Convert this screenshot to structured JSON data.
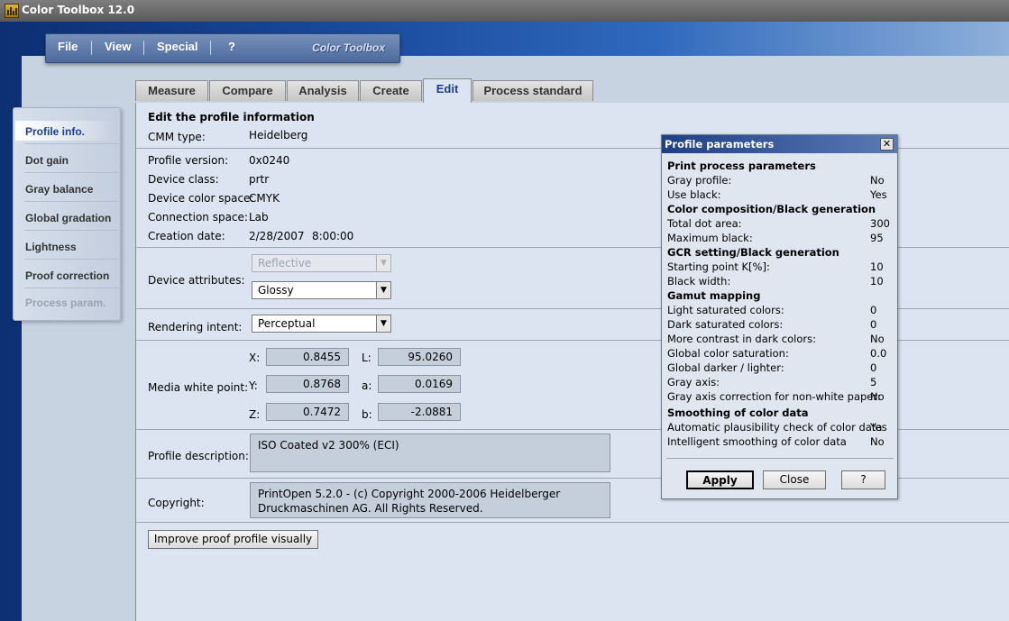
{
  "window": {
    "title": "Color Toolbox 12.0",
    "icon": "app-icon"
  },
  "menu": {
    "items": [
      "File",
      "View",
      "Special",
      "?"
    ],
    "brand": "Color Toolbox"
  },
  "tabs": [
    "Measure",
    "Compare",
    "Analysis",
    "Create",
    "Edit",
    "Process standard"
  ],
  "active_tab": "Edit",
  "sidebar": {
    "items": [
      "Profile info.",
      "Dot gain",
      "Gray balance",
      "Global gradation",
      "Lightness",
      "Proof correction",
      "Process param."
    ],
    "active": "Profile info.",
    "disabled": [
      "Process param."
    ]
  },
  "edit": {
    "heading": "Edit the profile information",
    "cmm_label": "CMM type:",
    "cmm_value": "Heidelberg",
    "version_label": "Profile version:",
    "version_value": "0x0240",
    "class_label": "Device class:",
    "class_value": "prtr",
    "colorspace_label": "Device color space:",
    "colorspace_value": "CMYK",
    "connection_label": "Connection space:",
    "connection_value": "Lab",
    "date_label": "Creation date:",
    "date_value": "2/28/2007",
    "time_value": "8:00:00",
    "attributes_label": "Device attributes:",
    "attr_reflective": "Reflective",
    "attr_glossy": "Glossy",
    "intent_label": "Rendering intent:",
    "intent_value": "Perceptual",
    "whitepoint_label": "Media white point:",
    "x_label": "X:",
    "x_value": "0.8455",
    "y_label": "Y:",
    "y_value": "0.8768",
    "z_label": "Z:",
    "z_value": "0.7472",
    "l_label": "L:",
    "l_value": "95.0260",
    "a_label": "a:",
    "a_value": "0.0169",
    "b_label": "b:",
    "b_value": "-2.0881",
    "description_label": "Profile description:",
    "description_value": "ISO Coated v2 300% (ECI)",
    "copyright_label": "Copyright:",
    "copyright_line1": "PrintOpen 5.2.0 - (c) Copyright 2000-2006 Heidelberger",
    "copyright_line2": "Druckmaschinen AG. All Rights Reserved.",
    "improve_button": "Improve proof profile visually"
  },
  "dialog": {
    "title": "Profile parameters",
    "close_glyph": "✕",
    "rows": [
      {
        "label": "Print process parameters",
        "value": "",
        "head": true
      },
      {
        "label": "Gray profile:",
        "value": "No"
      },
      {
        "label": "Use black:",
        "value": "Yes"
      },
      {
        "label": "Color composition/Black generation",
        "value": "",
        "head": true
      },
      {
        "label": "Total dot area:",
        "value": "300"
      },
      {
        "label": "Maximum black:",
        "value": "95"
      },
      {
        "label": "GCR setting/Black generation",
        "value": "",
        "head": true
      },
      {
        "label": "Starting point K[%]:",
        "value": "10"
      },
      {
        "label": "Black width:",
        "value": "10"
      },
      {
        "label": "Gamut mapping",
        "value": "",
        "head": true
      },
      {
        "label": "Light saturated colors:",
        "value": "0"
      },
      {
        "label": "Dark saturated colors:",
        "value": "0"
      },
      {
        "label": "More contrast in dark colors:",
        "value": "No"
      },
      {
        "label": "Global color saturation:",
        "value": "0.0"
      },
      {
        "label": "Global darker / lighter:",
        "value": "0"
      },
      {
        "label": "Gray axis:",
        "value": "5"
      },
      {
        "label": "Gray axis correction for non-white paper:",
        "value": "No"
      },
      {
        "label": "Smoothing of color data",
        "value": "",
        "head": true
      },
      {
        "label": "Automatic plausibility check of color data",
        "value": "Yes"
      },
      {
        "label": "Intelligent smoothing of color data",
        "value": "No"
      }
    ],
    "apply": "Apply",
    "close": "Close",
    "help": "?"
  },
  "colors": {
    "accent": "#1d3f8a",
    "desktop": "#1a4a9c",
    "panel": "#dbe4f0"
  }
}
